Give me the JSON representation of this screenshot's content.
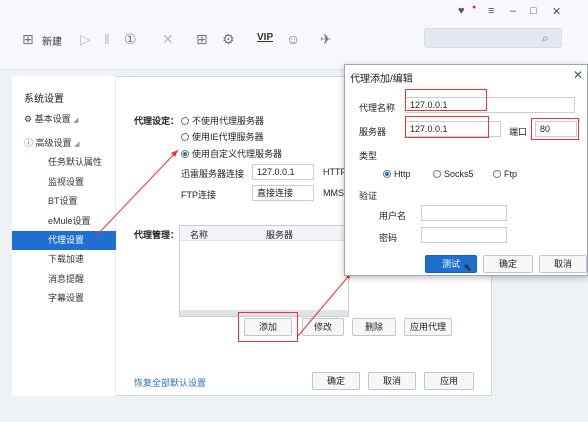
{
  "toolbar": {
    "new_label": "新建",
    "vip_label": "VIP"
  },
  "settings": {
    "title": "系统设置",
    "sidebar": [
      {
        "label": "基本设置"
      },
      {
        "label": "高级设置"
      },
      {
        "label": "任务默认属性"
      },
      {
        "label": "监视设置"
      },
      {
        "label": "BT设置"
      },
      {
        "label": "eMule设置"
      },
      {
        "label": "代理设置"
      },
      {
        "label": "下载加速"
      },
      {
        "label": "消息提醒"
      },
      {
        "label": "字幕设置"
      }
    ],
    "proxy_setting_label": "代理设定：",
    "radio_options": [
      "不使用代理服务器",
      "使用IE代理服务器",
      "使用自定义代理服务器"
    ],
    "xunlei_server_label": "迅雷服务器连接",
    "xunlei_server_value": "127.0.0.1",
    "http_label": "HTTP",
    "ftp_label": "FTP连接",
    "ftp_value": "直接连接",
    "mms_label": "MMS,",
    "proxy_manage_label": "代理管理：",
    "table_headers": [
      "名称",
      "服务器"
    ],
    "buttons": {
      "add": "添加",
      "edit": "修改",
      "delete": "删除",
      "apply_proxy": "应用代理"
    },
    "restore_defaults": "恢复全部默认设置",
    "ok": "确定",
    "cancel": "取消",
    "apply": "应用"
  },
  "dialog": {
    "title": "代理添加/编辑",
    "name_label": "代理名称",
    "name_value": "127.0.0.1",
    "server_label": "服务器",
    "server_value": "127.0.0.1",
    "port_label": "端口",
    "port_value": "80",
    "type_label": "类型",
    "types": [
      "Http",
      "Socks5",
      "Ftp"
    ],
    "auth_label": "验证",
    "user_label": "用户名",
    "password_label": "密码",
    "test": "测试",
    "ok": "确定",
    "cancel": "取消"
  },
  "colors": {
    "accent": "#1f6fd1",
    "annotation": "#e33333"
  }
}
